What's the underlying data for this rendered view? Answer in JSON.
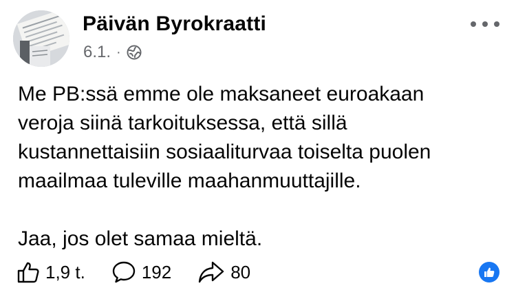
{
  "post": {
    "author": "Päivän Byrokraatti",
    "date": "6.1.",
    "separator": "·",
    "audience_icon": "globe-icon",
    "more_icon": "more-options-icon",
    "paragraphs": [
      [
        "Me PB:ssä emme ole maksaneet euroakaan",
        "veroja siinä tarkoituksessa, että sillä",
        "kustannettaisiin sosiaaliturvaa toiselta puolen",
        "maailmaa tuleville maahanmuuttajille."
      ],
      [
        "Jaa, jos olet samaa mieltä."
      ]
    ]
  },
  "actions": {
    "like": {
      "icon": "thumbs-up-icon",
      "count": "1,9 t."
    },
    "comment": {
      "icon": "comment-icon",
      "count": "192"
    },
    "share": {
      "icon": "share-icon",
      "count": "80"
    }
  },
  "colors": {
    "text": "#050505",
    "secondary": "#65676b",
    "accent": "#1877f2",
    "background": "#ffffff"
  }
}
